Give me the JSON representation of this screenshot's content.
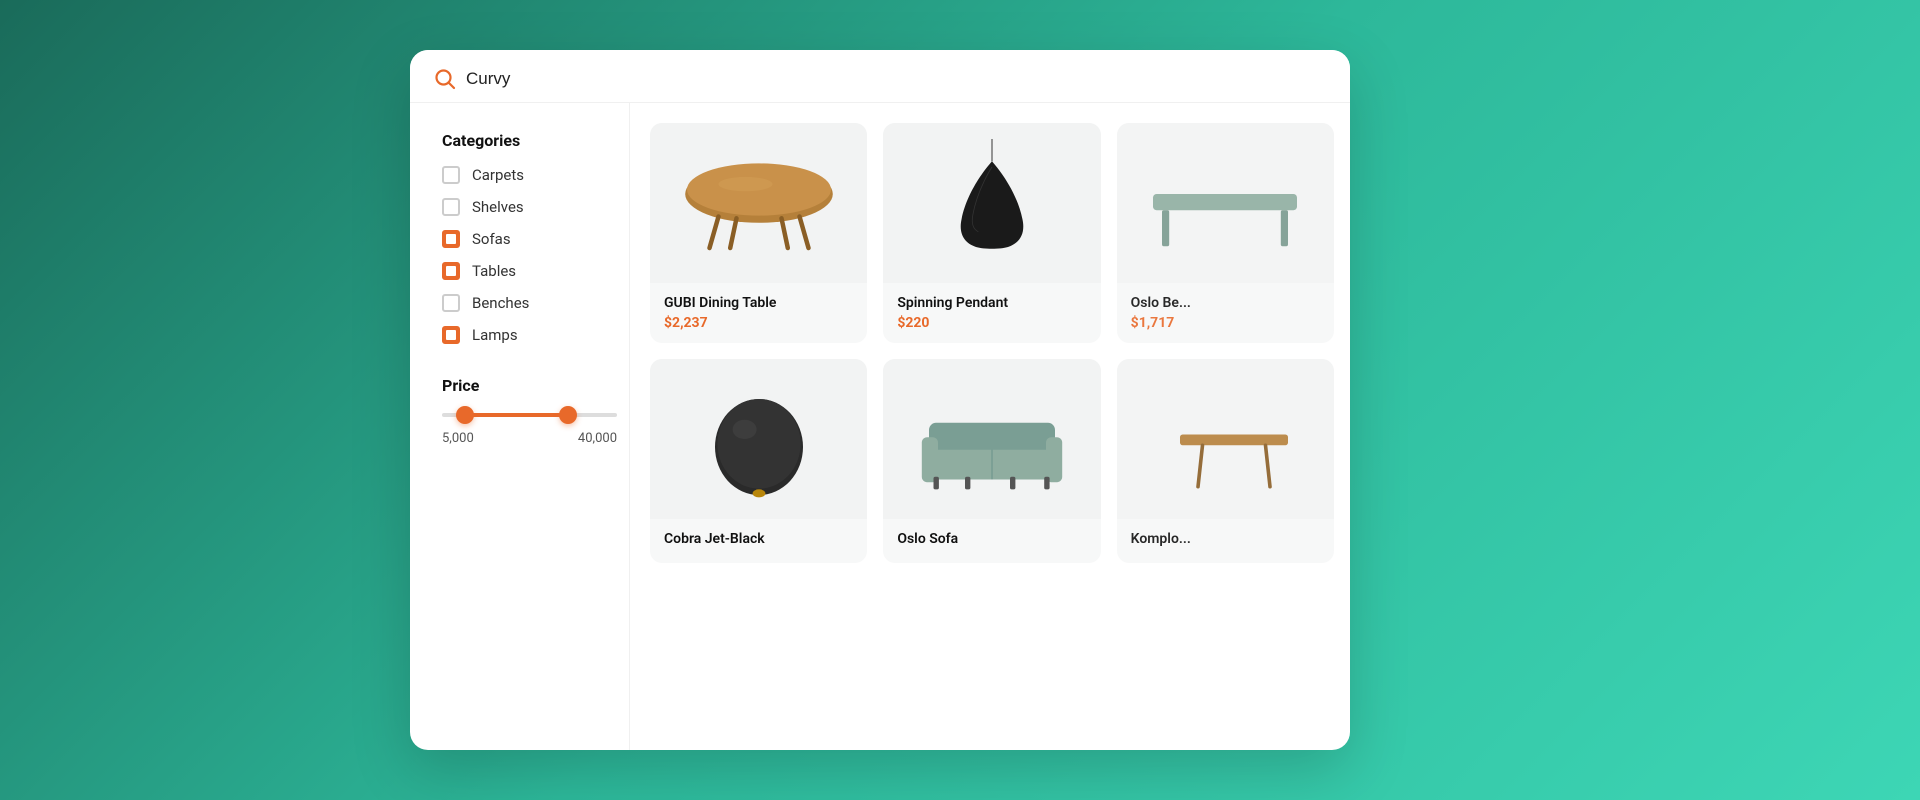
{
  "search": {
    "placeholder": "Search",
    "value": "Curvy",
    "icon": "search"
  },
  "sidebar": {
    "categories_title": "Categories",
    "categories": [
      {
        "id": "carpets",
        "label": "Carpets",
        "checked": false
      },
      {
        "id": "shelves",
        "label": "Shelves",
        "checked": false
      },
      {
        "id": "sofas",
        "label": "Sofas",
        "checked": true
      },
      {
        "id": "tables",
        "label": "Tables",
        "checked": true
      },
      {
        "id": "benches",
        "label": "Benches",
        "checked": false
      },
      {
        "id": "lamps",
        "label": "Lamps",
        "checked": true
      }
    ],
    "price_title": "Price",
    "price_min": "5,000",
    "price_max": "40,000"
  },
  "products": {
    "row1": [
      {
        "id": "gubi-dining",
        "name": "GUBI Dining Table",
        "price": "$2,237",
        "type": "dining-table"
      },
      {
        "id": "spinning-pendant",
        "name": "Spinning Pendant",
        "price": "$220",
        "type": "pendant-lamp"
      },
      {
        "id": "oslo-bench",
        "name": "Oslo Be...",
        "price": "$1,717",
        "type": "bench-partial"
      }
    ],
    "row2": [
      {
        "id": "cobra-jet",
        "name": "Cobra Jet-Black",
        "price": "",
        "type": "round-vase"
      },
      {
        "id": "oslo-sofa",
        "name": "Oslo Sofa",
        "price": "",
        "type": "sofa"
      },
      {
        "id": "komplo",
        "name": "Komplo...",
        "price": "",
        "type": "side-table-partial"
      }
    ]
  },
  "colors": {
    "accent": "#e8692a",
    "background_gradient_start": "#1a6b5a",
    "background_gradient_end": "#3dd6b5",
    "panel_bg": "#ffffff",
    "card_bg": "#f2f3f3"
  }
}
